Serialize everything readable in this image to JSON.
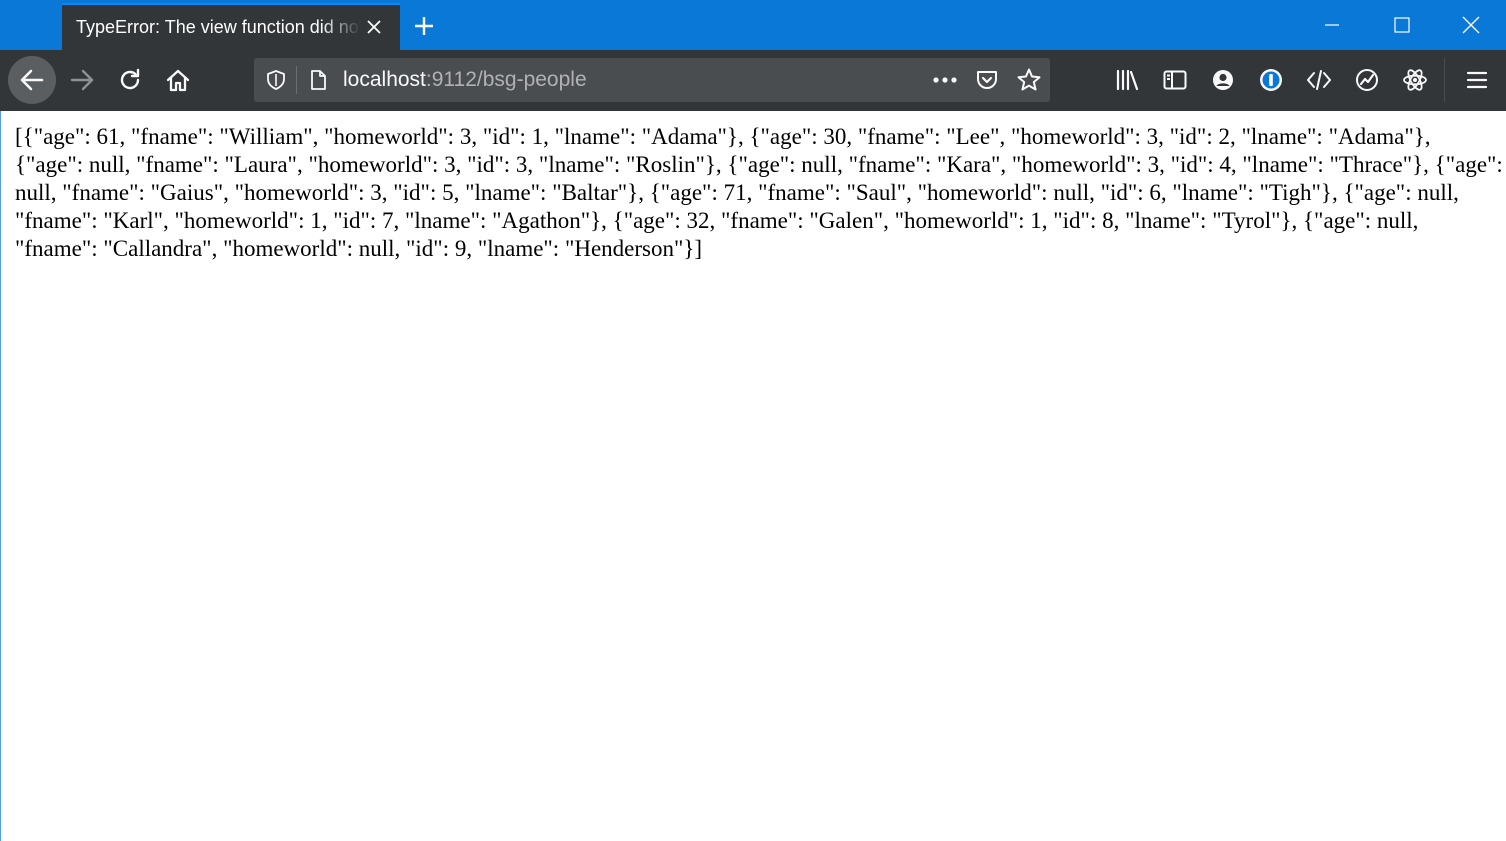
{
  "window": {
    "tab_title": "TypeError: The view function did not return a valid response",
    "new_tab_icon": "plus-icon",
    "controls": [
      "minimize-icon",
      "maximize-icon",
      "close-icon"
    ]
  },
  "toolbar": {
    "buttons": [
      "back-arrow-icon",
      "forward-arrow-icon",
      "reload-icon",
      "home-icon"
    ],
    "url": {
      "host": "localhost",
      "rest": ":9112/bsg-people"
    },
    "url_icons": [
      "shield-icon",
      "page-icon",
      "more-dots-icon",
      "pocket-icon",
      "bookmark-star-icon"
    ],
    "extensions": [
      "library-icon",
      "sidebar-icon",
      "account-icon",
      "password-manager-icon",
      "web-developer-icon",
      "extension-icon",
      "react-devtools-icon",
      "hamburger-menu-icon"
    ]
  },
  "page": {
    "body_text": "[{\"age\": 61, \"fname\": \"William\", \"homeworld\": 3, \"id\": 1, \"lname\": \"Adama\"}, {\"age\": 30, \"fname\": \"Lee\", \"homeworld\": 3, \"id\": 2, \"lname\": \"Adama\"}, {\"age\": null, \"fname\": \"Laura\", \"homeworld\": 3, \"id\": 3, \"lname\": \"Roslin\"}, {\"age\": null, \"fname\": \"Kara\", \"homeworld\": 3, \"id\": 4, \"lname\": \"Thrace\"}, {\"age\": null, \"fname\": \"Gaius\", \"homeworld\": 3, \"id\": 5, \"lname\": \"Baltar\"}, {\"age\": 71, \"fname\": \"Saul\", \"homeworld\": null, \"id\": 6, \"lname\": \"Tigh\"}, {\"age\": null, \"fname\": \"Karl\", \"homeworld\": 1, \"id\": 7, \"lname\": \"Agathon\"}, {\"age\": 32, \"fname\": \"Galen\", \"homeworld\": 1, \"id\": 8, \"lname\": \"Tyrol\"}, {\"age\": null, \"fname\": \"Callandra\", \"homeworld\": null, \"id\": 9, \"lname\": \"Henderson\"}]"
  },
  "colors": {
    "titlebar": "#0a78d7",
    "toolbar": "#323639",
    "urlbar": "#4a4d50",
    "icon": "#f9f9fa"
  }
}
